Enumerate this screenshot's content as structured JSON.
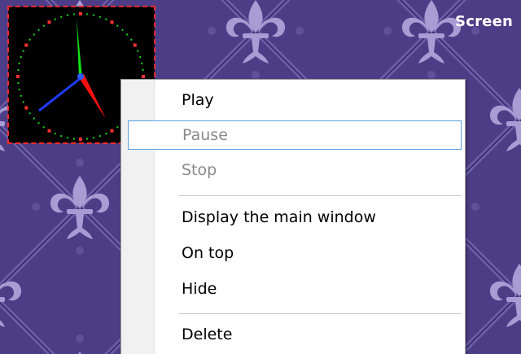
{
  "desktop": {
    "screen_label": "Screen",
    "wallpaper_colors": {
      "base": "#4c3d86",
      "pattern": "#a79cd3"
    }
  },
  "clock": {
    "colors": {
      "background": "#000000",
      "border": "#ff2a2a",
      "dots": "#1ec81e",
      "hour_marks": "#ff3030",
      "hand_green": "#14e014",
      "hand_red": "#ff1010",
      "hand_blue": "#1e3cff"
    }
  },
  "context_menu": {
    "items": [
      {
        "label": "Play",
        "disabled": false,
        "highlighted": false
      },
      {
        "label": "Pause",
        "disabled": true,
        "highlighted": true
      },
      {
        "label": "Stop",
        "disabled": true,
        "highlighted": false
      },
      {
        "label": "Display the main window",
        "disabled": false,
        "highlighted": false
      },
      {
        "label": "On top",
        "disabled": false,
        "highlighted": false
      },
      {
        "label": "Hide",
        "disabled": false,
        "highlighted": false
      },
      {
        "label": "Delete",
        "disabled": false,
        "highlighted": false
      }
    ]
  }
}
